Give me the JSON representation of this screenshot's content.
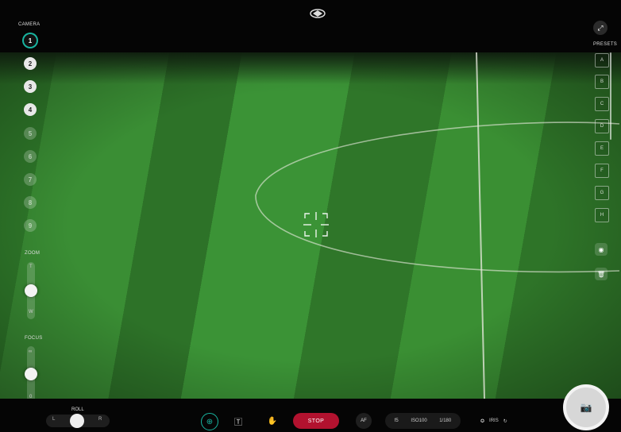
{
  "left_panel": {
    "camera_title": "CAMERA",
    "cameras": [
      "1",
      "2",
      "3",
      "4",
      "5",
      "6",
      "7",
      "8",
      "9"
    ],
    "active_camera": "1",
    "zoom_label": "ZOOM",
    "zoom_top": "T",
    "zoom_bottom": "W",
    "focus_label": "FOCUS",
    "focus_top": "∞",
    "focus_bottom": "0"
  },
  "right_panel": {
    "presets_title": "PRESETS",
    "presets": [
      "A",
      "B",
      "C",
      "D",
      "E",
      "F",
      "G",
      "H"
    ]
  },
  "bottom_bar": {
    "roll_label": "ROLL",
    "roll_left": "L",
    "roll_right": "R",
    "stop_label": "STOP",
    "af_label": "AF",
    "aperture": "f5",
    "iso": "ISO100",
    "shutter": "1/180",
    "iris_label": "IRIS"
  },
  "colors": {
    "accent": "#19b4a0",
    "stop": "#b2122f",
    "field_light": "#3b9336",
    "field_dark": "#2d7228"
  }
}
